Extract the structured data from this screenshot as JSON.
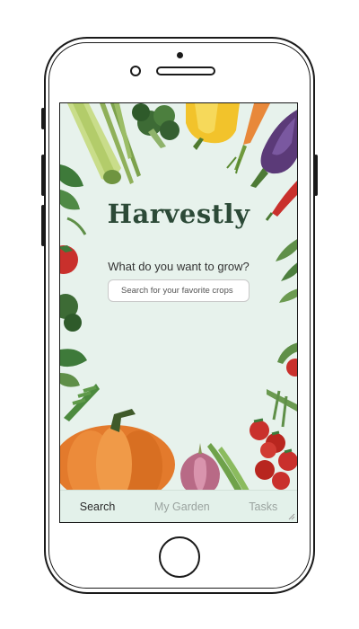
{
  "app": {
    "title": "Harvestly",
    "prompt": "What do you want to grow?"
  },
  "search": {
    "placeholder": "Search for your favorite crops"
  },
  "tabs": [
    {
      "label": "Search",
      "active": true
    },
    {
      "label": "My Garden",
      "active": false
    },
    {
      "label": "Tasks",
      "active": false
    }
  ],
  "colors": {
    "screen_bg": "#e7f2ec",
    "title": "#2c4a37",
    "tab_active": "#2a2a2a",
    "tab_inactive": "#9aa39f"
  },
  "decorations": [
    "zucchini",
    "broccoli",
    "asparagus",
    "yellow-pepper",
    "carrot",
    "eggplant",
    "red-chili",
    "basil",
    "tomato",
    "pumpkin",
    "onion",
    "pea-pods",
    "cherry-tomatoes"
  ]
}
